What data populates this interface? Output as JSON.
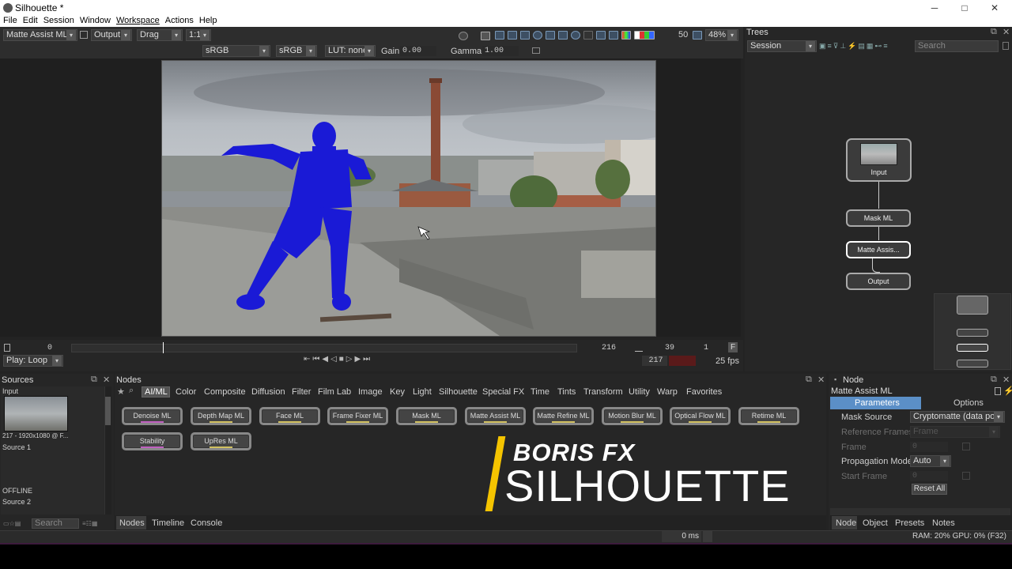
{
  "window": {
    "title": "Silhouette *",
    "minimize": "─",
    "maximize": "□",
    "close": "✕"
  },
  "menu": [
    "File",
    "Edit",
    "Session",
    "Window",
    "Workspace",
    "Actions",
    "Help"
  ],
  "viewer_toolbar": {
    "node_select": "Matte Assist ML",
    "output_select": "Output",
    "tool_select": "Drag",
    "ratio_select": "1:1",
    "frame_num": "50",
    "zoom": "48%",
    "colorspace_left": "sRGB",
    "colorspace_right": "sRGB",
    "lut": "LUT: none",
    "gain_label": "Gain",
    "gain_value": "0.00",
    "gamma_label": "Gamma",
    "gamma_value": "1.00"
  },
  "timeline": {
    "start": "0",
    "end": "216",
    "range_a": "39",
    "range_b": "1",
    "f_button": "F",
    "play_mode": "Play: Loop",
    "current_frame": "217",
    "fps": "25 fps"
  },
  "trees": {
    "title": "Trees",
    "session_select": "Session",
    "search_placeholder": "Search",
    "nodes": [
      "Input",
      "Mask ML",
      "Matte Assis...",
      "Output"
    ]
  },
  "sources": {
    "title": "Sources",
    "items": [
      {
        "name": "Input",
        "info": "217 - 1920x1080 @ F..."
      },
      {
        "name": "Source 1",
        "info": "OFFLINE"
      },
      {
        "name": "Source 2",
        "info": ""
      }
    ],
    "search_placeholder": "Search"
  },
  "nodes_panel": {
    "title": "Nodes",
    "categories": [
      "AI/ML",
      "Color",
      "Composite",
      "Diffusion",
      "Filter",
      "Film Lab",
      "Image",
      "Key",
      "Light",
      "Silhouette",
      "Special FX",
      "Time",
      "Tints",
      "Transform",
      "Utility",
      "Warp",
      "Favorites"
    ],
    "buttons": [
      "Denoise ML",
      "Depth Map ML",
      "Face ML",
      "Frame Fixer ML",
      "Mask ML",
      "Matte Assist ML",
      "Matte Refine ML",
      "Motion Blur ML",
      "Optical Flow ML",
      "Retime ML",
      "Stability",
      "UpRes ML"
    ],
    "tabs": [
      "Nodes",
      "Timeline",
      "Console"
    ]
  },
  "branding": {
    "line1": "BORIS FX",
    "line2": "SILHOUETTE"
  },
  "node_panel": {
    "title": "Node",
    "node_name": "Matte Assist ML",
    "tab_parameters": "Parameters",
    "tab_options": "Options",
    "params": [
      {
        "label": "Mask Source",
        "value": "Cryptomatte (data port)"
      },
      {
        "label": "Reference Frames",
        "value": "Frame"
      },
      {
        "label": "Frame",
        "value": "0"
      },
      {
        "label": "Propagation Mode",
        "value": "Auto"
      },
      {
        "label": "Start Frame",
        "value": "0"
      }
    ],
    "reset": "Reset All",
    "bottom_tabs": [
      "Node",
      "Object",
      "Presets",
      "Notes"
    ]
  },
  "status": {
    "time": "0 ms",
    "ram": "RAM: 20% GPU: 0% (F32)"
  },
  "colors": {
    "accent": "#5b8fc7",
    "panel": "#2b2b2b",
    "brand_yellow": "#f5c400",
    "matte_blue": "#1a1ad6"
  }
}
